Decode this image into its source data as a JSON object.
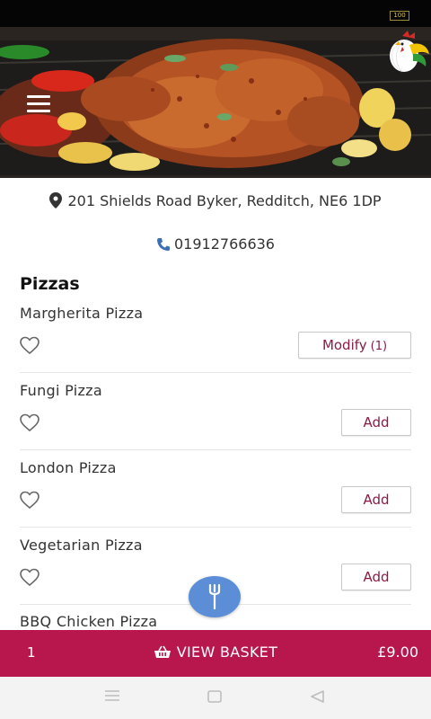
{
  "status_bar": {
    "battery": "100"
  },
  "restaurant": {
    "address": "201 Shields Road Byker, Redditch, NE6 1DP",
    "phone": "01912766636"
  },
  "section": {
    "title": "Pizzas"
  },
  "menu_items": [
    {
      "name": "Margherita Pizza",
      "button": "Modify",
      "count": "(1)"
    },
    {
      "name": "Fungi Pizza",
      "button": "Add"
    },
    {
      "name": "London Pizza",
      "button": "Add"
    },
    {
      "name": "Vegetarian Pizza",
      "button": "Add"
    },
    {
      "name": "BBQ Chicken Pizza"
    }
  ],
  "basket": {
    "quantity": "1",
    "label": "VIEW BASKET",
    "total": "£9.00"
  },
  "colors": {
    "accent": "#b8174d",
    "button_text": "#8b1a45",
    "fab": "#5b8ed6",
    "icon_blue": "#3b6fb8"
  },
  "icons": [
    "menu-icon",
    "logo-rooster",
    "location-pin-icon",
    "phone-icon",
    "heart-icon",
    "fork-icon",
    "basket-icon",
    "nav-menu-icon",
    "nav-home-icon",
    "nav-back-icon"
  ]
}
